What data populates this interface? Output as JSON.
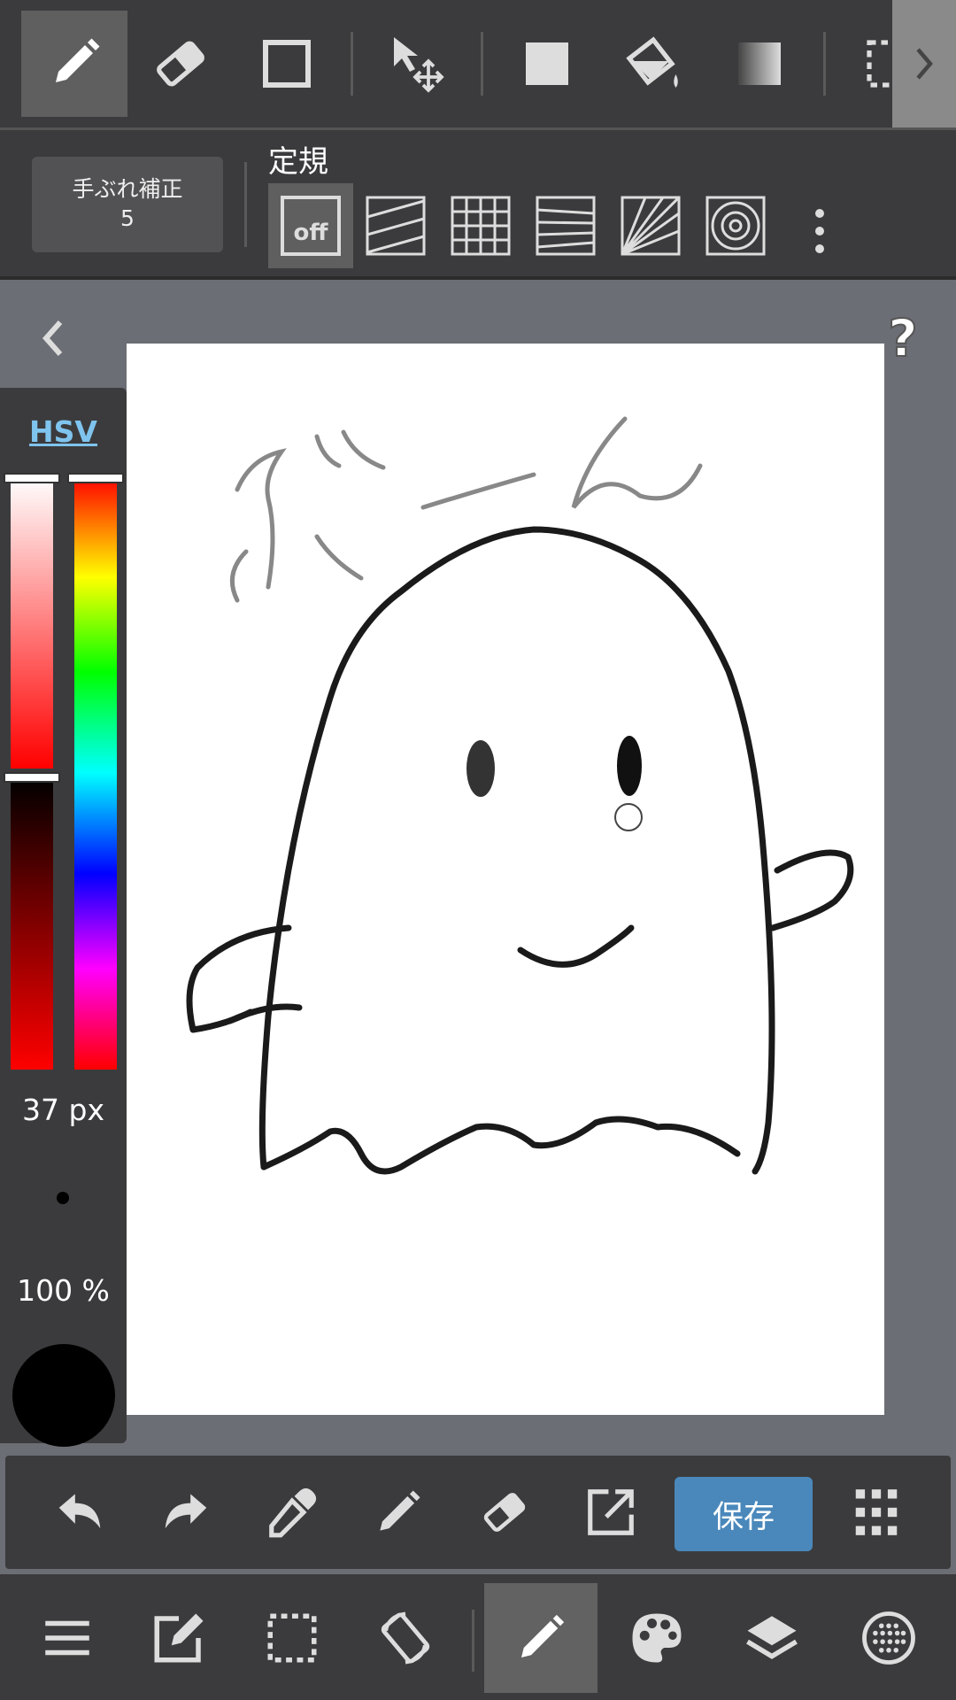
{
  "toolbar": {
    "tools": [
      {
        "id": "pen",
        "icon": "pen-icon",
        "active": true
      },
      {
        "id": "eraser",
        "icon": "eraser-icon"
      },
      {
        "id": "shape",
        "icon": "rectangle-outline-icon"
      },
      {
        "id": "move",
        "icon": "move-icon"
      },
      {
        "id": "fill-rect",
        "icon": "filled-square-icon"
      },
      {
        "id": "bucket",
        "icon": "bucket-fill-icon"
      },
      {
        "id": "gradient",
        "icon": "gradient-icon"
      },
      {
        "id": "select",
        "icon": "selection-icon"
      }
    ]
  },
  "stabilizer": {
    "label": "手ぶれ補正",
    "value": "5"
  },
  "ruler": {
    "label": "定規",
    "off_label": "off",
    "options": [
      "off",
      "parallel",
      "grid",
      "perspective",
      "radial",
      "concentric"
    ]
  },
  "color_panel": {
    "mode_label": "HSV",
    "brush_size": "37 px",
    "opacity": "100 %",
    "current_color": "#000000"
  },
  "canvas": {
    "text": "ぶーん"
  },
  "actions": {
    "save_label": "保存"
  },
  "colors": {
    "accent": "#4a88bb",
    "toolbar_bg": "#3b3b3d",
    "canvas_bg": "#6b6e74"
  }
}
